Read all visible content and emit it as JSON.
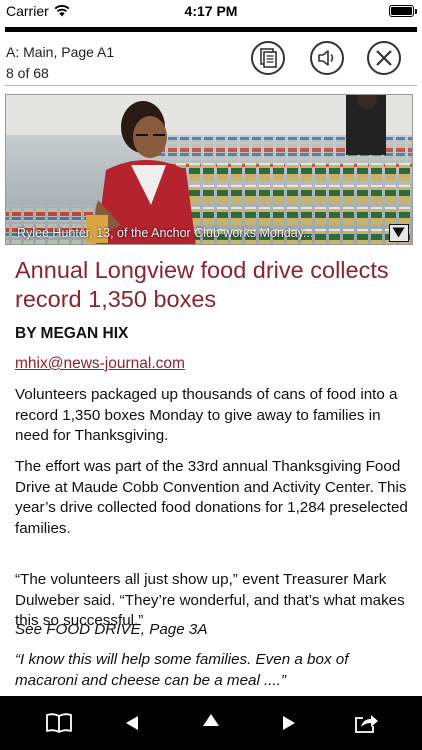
{
  "status_bar": {
    "carrier": "Carrier",
    "time": "4:17 PM",
    "battery_level": 1.0
  },
  "header": {
    "section": "A: Main, Page A1",
    "page_count": "8 of 68",
    "buttons": {
      "pages": "pages-icon",
      "audio": "speaker-icon",
      "close": "close-icon"
    }
  },
  "photo": {
    "caption": "Rylee Hunter, 13, of the Anchor Club works Monday...",
    "expand_icon": "triangle-down-icon"
  },
  "article": {
    "headline": "Annual Longview food drive collects record 1,350 boxes",
    "byline": "BY MEGAN HIX",
    "email": "mhix@news-journal.com",
    "paragraphs": [
      "Volunteers packaged up thousands of cans of food into a record 1,350 boxes Monday to give away to families in need for Thanksgiving.",
      "The effort was part of the 33rd annual Thanksgiving Food Drive at Maude Cobb Convention and Activity Center. This year’s drive collected food donations for 1,284 preselected families.",
      "“The volunteers all just show up,” event Treasurer Mark Dulweber said. “They’re wonderful, and that’s what makes this so successful.”",
      "See FOOD DRIVE, Page 3A",
      "“I know this will help some families. Even a box of macaroni and cheese can be a meal ....”"
    ]
  },
  "toolbar": {
    "items": [
      "library-book-icon",
      "previous-arrow-icon",
      "up-arrow-icon",
      "next-arrow-icon",
      "share-icon"
    ]
  },
  "colors": {
    "accent": "#8b2330",
    "toolbar_bg": "#000000"
  }
}
